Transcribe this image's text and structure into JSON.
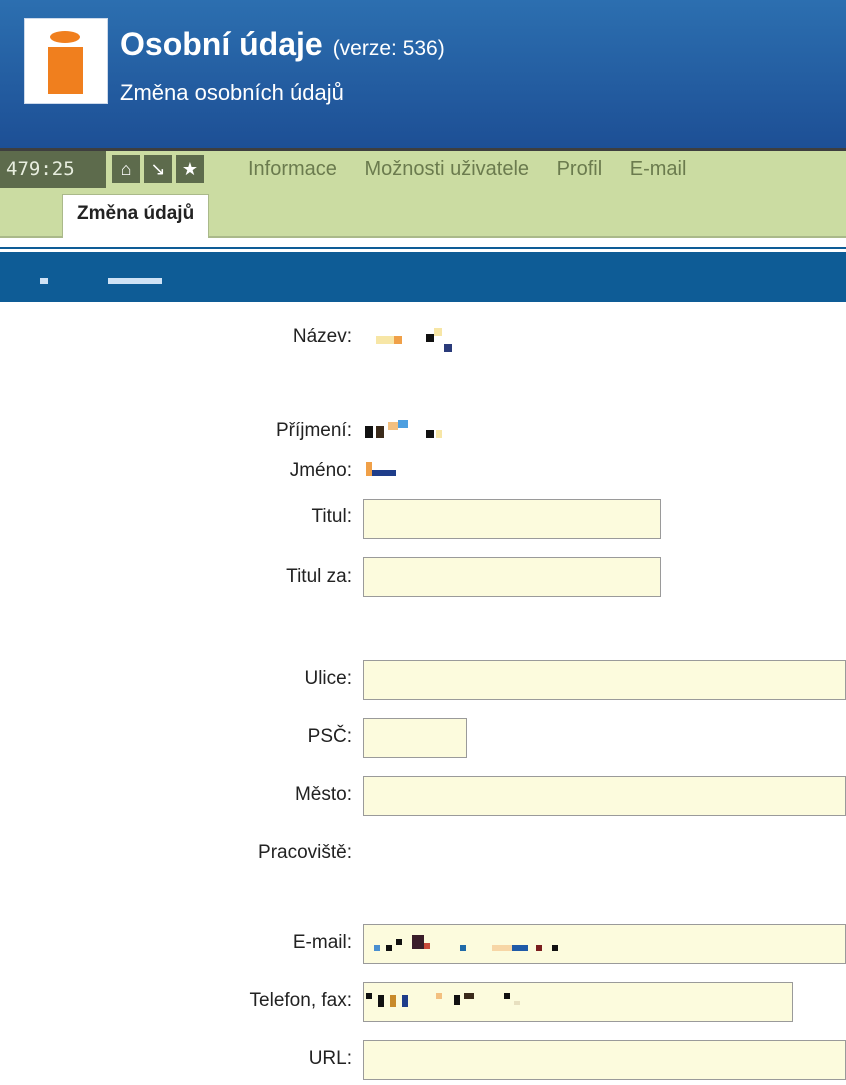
{
  "app": {
    "title": "Osobní údaje",
    "version": "(verze: 536)",
    "subtitle": "Změna osobních údajů"
  },
  "navbar": {
    "counter": "479:25",
    "icons": [
      "home-icon",
      "arrow-down-right-icon",
      "star-icon"
    ],
    "links": [
      "Informace",
      "Možnosti uživatele",
      "Profil",
      "E-mail"
    ]
  },
  "tabs": {
    "active": "Změna údajů"
  },
  "form": {
    "labels": {
      "nazev": "Název:",
      "prijmeni": "Příjmení:",
      "jmeno": "Jméno:",
      "titul": "Titul:",
      "titul_za": "Titul za:",
      "ulice": "Ulice:",
      "psc": "PSČ:",
      "mesto": "Město:",
      "pracoviste": "Pracoviště:",
      "email": "E-mail:",
      "telefon": "Telefon, fax:",
      "url": "URL:"
    },
    "values": {
      "titul": "",
      "titul_za": "",
      "ulice": "",
      "psc": "",
      "mesto": "",
      "url": ""
    }
  },
  "colors": {
    "header": "#1d4f95",
    "navbar": "#cbdca2",
    "strip": "#0e5c96",
    "input_bg": "#fcfbdd",
    "logo": "#f07f1e"
  }
}
